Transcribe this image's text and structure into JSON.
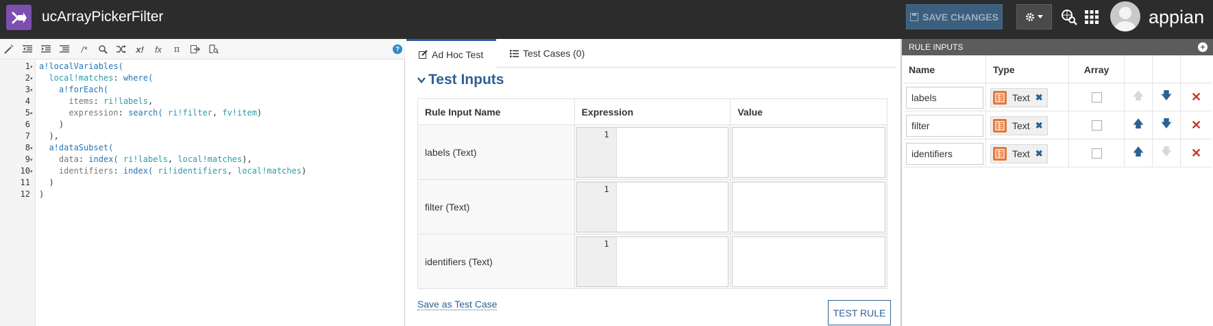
{
  "header": {
    "app_title": "ucArrayPickerFilter",
    "save_label": "SAVE CHANGES",
    "brand": "appian"
  },
  "editor": {
    "toolbar_icons": [
      "magic-wand-icon",
      "outdent-icon",
      "indent-icon",
      "format-icon",
      "comment-icon",
      "search-icon",
      "shuffle-icon",
      "x-factorial-icon",
      "fx-icon",
      "pi-icon",
      "export-icon",
      "document-search-icon"
    ],
    "lines": [
      {
        "n": "1",
        "fold": true
      },
      {
        "n": "2",
        "fold": true
      },
      {
        "n": "3",
        "fold": true
      },
      {
        "n": "4",
        "fold": false
      },
      {
        "n": "5",
        "fold": true
      },
      {
        "n": "6",
        "fold": false
      },
      {
        "n": "7",
        "fold": false
      },
      {
        "n": "8",
        "fold": true
      },
      {
        "n": "9",
        "fold": true
      },
      {
        "n": "10",
        "fold": true
      },
      {
        "n": "11",
        "fold": false
      },
      {
        "n": "12",
        "fold": false
      }
    ],
    "code": {
      "l1": "a!localVariables(",
      "l2a": "local!matches",
      "l2b": ": ",
      "l2c": "where(",
      "l3": "a!forEach(",
      "l4a": "items",
      "l4b": ": ",
      "l4c": "ri!labels",
      "l4d": ",",
      "l5a": "expression",
      "l5b": ": ",
      "l5c": "search(",
      "l5d": " ri!filter",
      "l5e": ", ",
      "l5f": "fv!item",
      "l5g": ")",
      "l6": ")",
      "l7": "),",
      "l8": "a!dataSubset(",
      "l9a": "data",
      "l9b": ": ",
      "l9c": "index(",
      "l9d": " ri!labels",
      "l9e": ", ",
      "l9f": "local!matches",
      "l9g": "),",
      "l10a": "identifiers",
      "l10b": ": ",
      "l10c": "index(",
      "l10d": " ri!identifiers",
      "l10e": ", ",
      "l10f": "local!matches",
      "l10g": ")",
      "l11": ")",
      "l12": ")"
    }
  },
  "middle": {
    "tabs": [
      {
        "label": "Ad Hoc Test",
        "icon": "edit-icon",
        "active": true
      },
      {
        "label": "Test Cases (0)",
        "icon": "list-icon",
        "active": false
      }
    ],
    "section_title": "Test Inputs",
    "columns": [
      "Rule Input Name",
      "Expression",
      "Value"
    ],
    "rows": [
      {
        "name": "labels (Text)",
        "line": "1"
      },
      {
        "name": "filter (Text)",
        "line": "1"
      },
      {
        "name": "identifiers (Text)",
        "line": "1"
      }
    ],
    "save_link": "Save as Test Case",
    "test_button": "TEST RULE"
  },
  "right": {
    "header": "RULE INPUTS",
    "columns": [
      "Name",
      "Type",
      "Array"
    ],
    "inputs": [
      {
        "name": "labels",
        "type": "Text",
        "up_enabled": false,
        "down_enabled": true
      },
      {
        "name": "filter",
        "type": "Text",
        "up_enabled": true,
        "down_enabled": true
      },
      {
        "name": "identifiers",
        "type": "Text",
        "up_enabled": true,
        "down_enabled": false
      }
    ]
  }
}
